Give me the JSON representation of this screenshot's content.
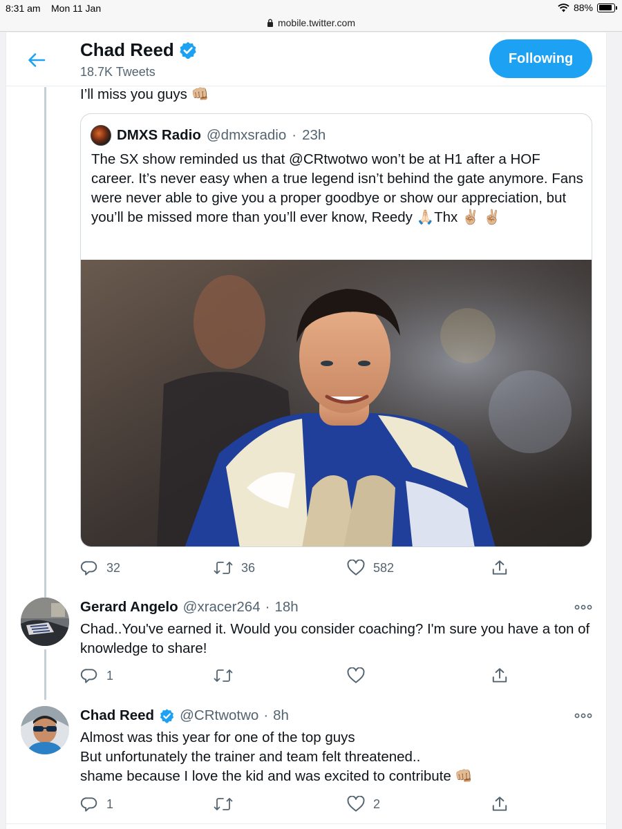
{
  "status_bar": {
    "time": "8:31 am",
    "date": "Mon 11 Jan",
    "battery": "88%",
    "battery_level": 0.88
  },
  "browser": {
    "url": "mobile.twitter.com"
  },
  "header": {
    "name": "Chad Reed",
    "tweet_count": "18.7K Tweets",
    "follow_label": "Following"
  },
  "main_tweet": {
    "text": "I’ll miss you guys 👊🏼",
    "quote": {
      "name": "DMXS Radio",
      "handle": "@dmxsradio",
      "sep": "·",
      "time": "23h",
      "text": "The SX show reminded us that @CRtwotwo won’t be at H1 after a HOF career. It’s never easy when a true legend isn’t behind the gate anymore. Fans were never able to give you a proper goodbye or show our appreciation, but you’ll be missed more than you’ll ever know, Reedy 🙏🏻Thx ✌🏼 ✌🏼"
    },
    "actions": {
      "replies": "32",
      "retweets": "36",
      "likes": "582"
    }
  },
  "replies": [
    {
      "name": "Gerard Angelo",
      "handle": "@xracer264",
      "sep": "·",
      "time": "18h",
      "text": "Chad..You've earned it. Would you consider coaching? I'm sure you have a ton of knowledge to share!",
      "actions": {
        "replies": "1",
        "retweets": "",
        "likes": ""
      }
    },
    {
      "name": "Chad Reed",
      "handle": "@CRtwotwo",
      "sep": "·",
      "time": "8h",
      "text_lines": [
        "Almost was this year for one of the top guys",
        "But unfortunately the trainer and team felt threatened..",
        "shame because I love the kid and was excited to contribute 👊🏼"
      ],
      "actions": {
        "replies": "1",
        "retweets": "",
        "likes": "2"
      }
    }
  ],
  "colors": {
    "accent": "#1da1f2",
    "text": "#0f1419",
    "muted": "#536471",
    "border": "#e6ecf0"
  }
}
